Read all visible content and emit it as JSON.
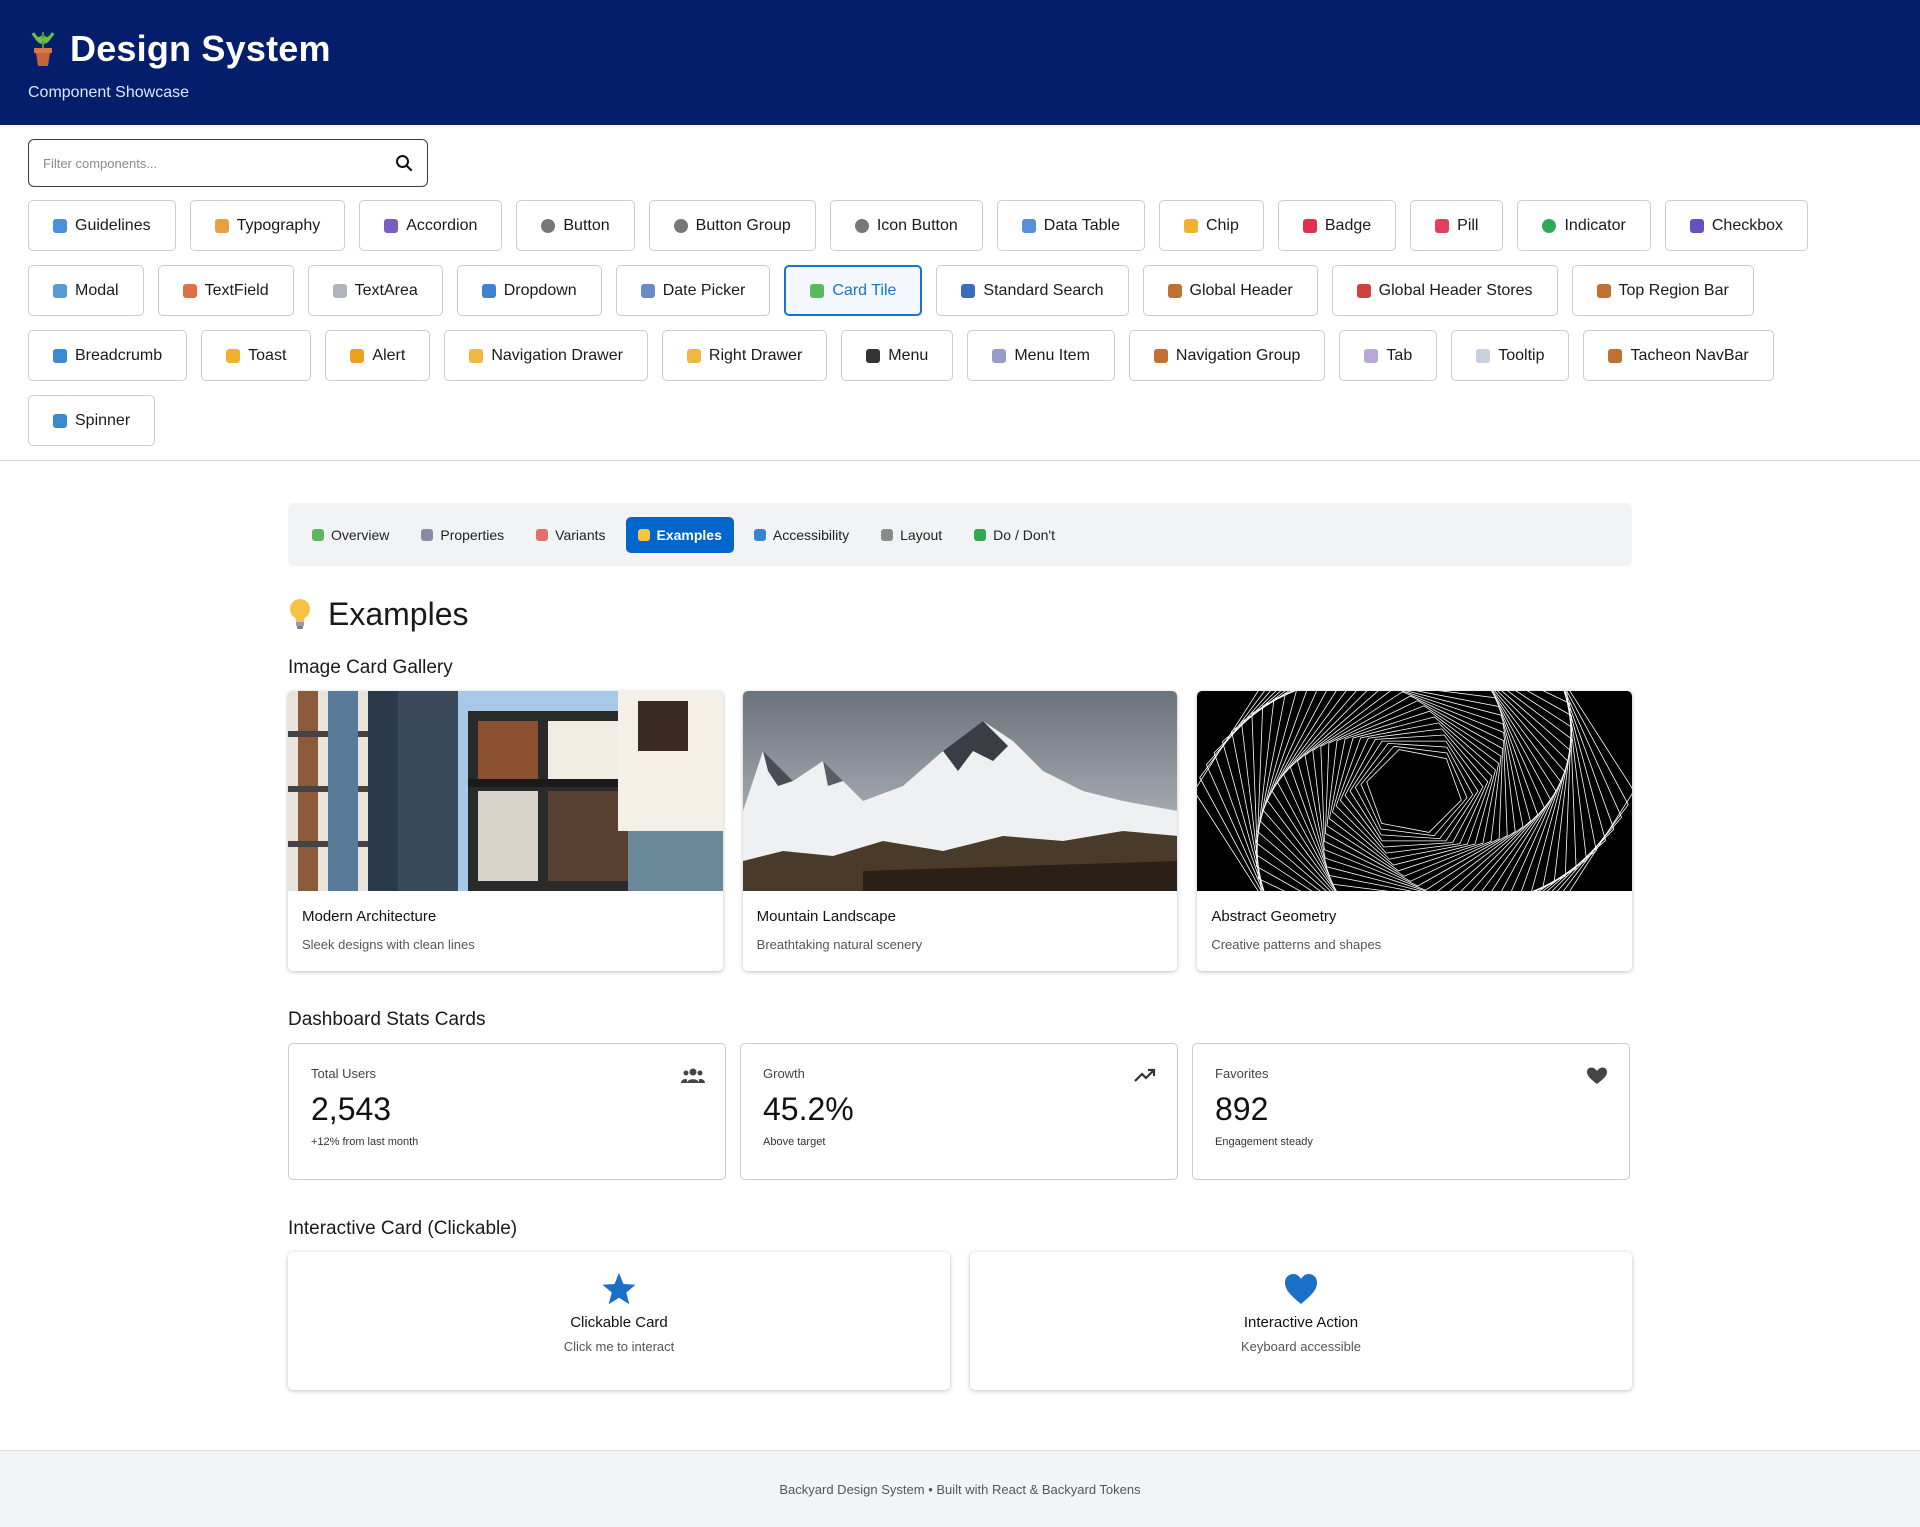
{
  "header": {
    "title": "Design System",
    "subtitle": "Component Showcase"
  },
  "filter": {
    "placeholder": "Filter components..."
  },
  "components": {
    "row1": [
      {
        "label": "Guidelines",
        "icon": "book-icon",
        "color": "#4a90d9"
      },
      {
        "label": "Typography",
        "icon": "writing-hand-icon",
        "color": "#e8a040"
      },
      {
        "label": "Accordion",
        "icon": "books-icon",
        "color": "#7a5cc4"
      },
      {
        "label": "Button",
        "icon": "radio-button-icon",
        "color": "#777777"
      },
      {
        "label": "Button Group",
        "icon": "radio-button-icon",
        "color": "#777777"
      },
      {
        "label": "Icon Button",
        "icon": "radio-button-icon",
        "color": "#777777"
      },
      {
        "label": "Data Table",
        "icon": "bar-chart-icon",
        "color": "#5a8fd8"
      },
      {
        "label": "Chip",
        "icon": "ticket-icon",
        "color": "#f0b030"
      },
      {
        "label": "Badge",
        "icon": "badge-icon",
        "color": "#e03050"
      },
      {
        "label": "Pill",
        "icon": "pill-icon",
        "color": "#e04060"
      },
      {
        "label": "Indicator",
        "icon": "green-dot-icon",
        "color": "#2eaa55"
      },
      {
        "label": "Checkbox",
        "icon": "checkbox-icon",
        "color": "#6a4fc0"
      }
    ],
    "row2": [
      {
        "label": "Modal",
        "icon": "window-icon",
        "color": "#5a9ad8"
      },
      {
        "label": "TextField",
        "icon": "memo-icon",
        "color": "#e0704a"
      },
      {
        "label": "TextArea",
        "icon": "page-icon",
        "color": "#b0b4bc"
      },
      {
        "label": "Dropdown",
        "icon": "dropdown-icon",
        "color": "#3a84d0"
      },
      {
        "label": "Date Picker",
        "icon": "calendar-icon",
        "color": "#6a8ac8"
      },
      {
        "label": "Card Tile",
        "icon": "puzzle-icon",
        "color": "#5cb85c",
        "active": true
      },
      {
        "label": "Standard Search",
        "icon": "magnifier-icon",
        "color": "#3a6cc0"
      },
      {
        "label": "Global Header",
        "icon": "compass-icon",
        "color": "#c07030"
      },
      {
        "label": "Global Header Stores",
        "icon": "store-icon",
        "color": "#d04040"
      },
      {
        "label": "Top Region Bar",
        "icon": "compass-icon",
        "color": "#c07030"
      }
    ],
    "row3": [
      {
        "label": "Breadcrumb",
        "icon": "map-icon",
        "color": "#3a8ad0"
      },
      {
        "label": "Toast",
        "icon": "bell-icon",
        "color": "#f0b030"
      },
      {
        "label": "Alert",
        "icon": "warning-icon",
        "color": "#f0a020"
      },
      {
        "label": "Navigation Drawer",
        "icon": "folder-icon",
        "color": "#f0b840"
      },
      {
        "label": "Right Drawer",
        "icon": "folder-icon",
        "color": "#f0b840"
      },
      {
        "label": "Menu",
        "icon": "film-icon",
        "color": "#333333"
      },
      {
        "label": "Menu Item",
        "icon": "page-icon",
        "color": "#9a9cc8"
      },
      {
        "label": "Navigation Group",
        "icon": "compass-icon",
        "color": "#c07030"
      },
      {
        "label": "Tab",
        "icon": "tab-icon",
        "color": "#b8a8d8"
      },
      {
        "label": "Tooltip",
        "icon": "speech-bubble-icon",
        "color": "#c8d0e0"
      },
      {
        "label": "Tacheon NavBar",
        "icon": "compass-icon",
        "color": "#c07030"
      }
    ],
    "row4": [
      {
        "label": "Spinner",
        "icon": "refresh-icon",
        "color": "#3a8ad0"
      }
    ]
  },
  "tabs": [
    {
      "label": "Overview",
      "icon": "puzzle-icon",
      "color": "#5cb85c"
    },
    {
      "label": "Properties",
      "icon": "gear-icon",
      "color": "#8a8aa8"
    },
    {
      "label": "Variants",
      "icon": "palette-icon",
      "color": "#e0706a"
    },
    {
      "label": "Examples",
      "icon": "bulb-icon",
      "color": "#f5c542",
      "active": true
    },
    {
      "label": "Accessibility",
      "icon": "accessibility-icon",
      "color": "#3a84d0"
    },
    {
      "label": "Layout",
      "icon": "ruler-icon",
      "color": "#8a8a8a"
    },
    {
      "label": "Do / Don't",
      "icon": "check-icon",
      "color": "#2eaa55"
    }
  ],
  "examples": {
    "title": "Examples",
    "gallery_heading": "Image Card Gallery",
    "gallery": [
      {
        "title": "Modern Architecture",
        "subtitle": "Sleek designs with clean lines"
      },
      {
        "title": "Mountain Landscape",
        "subtitle": "Breathtaking natural scenery"
      },
      {
        "title": "Abstract Geometry",
        "subtitle": "Creative patterns and shapes"
      }
    ],
    "stats_heading": "Dashboard Stats Cards",
    "stats": [
      {
        "label": "Total Users",
        "value": "2,543",
        "note": "+12% from last month",
        "icon": "users-icon"
      },
      {
        "label": "Growth",
        "value": "45.2%",
        "note": "Above target",
        "icon": "trending-up-icon"
      },
      {
        "label": "Favorites",
        "value": "892",
        "note": "Engagement steady",
        "icon": "heart-icon"
      }
    ],
    "interactive_heading": "Interactive Card (Clickable)",
    "interactive": [
      {
        "title": "Clickable Card",
        "subtitle": "Click me to interact",
        "icon": "star-icon"
      },
      {
        "title": "Interactive Action",
        "subtitle": "Keyboard accessible",
        "icon": "heart-icon"
      }
    ]
  },
  "colors": {
    "header_bg": "#041e6b",
    "accent": "#0066cc"
  },
  "footer": {
    "text": "Backyard Design System • Built with React & Backyard Tokens"
  }
}
